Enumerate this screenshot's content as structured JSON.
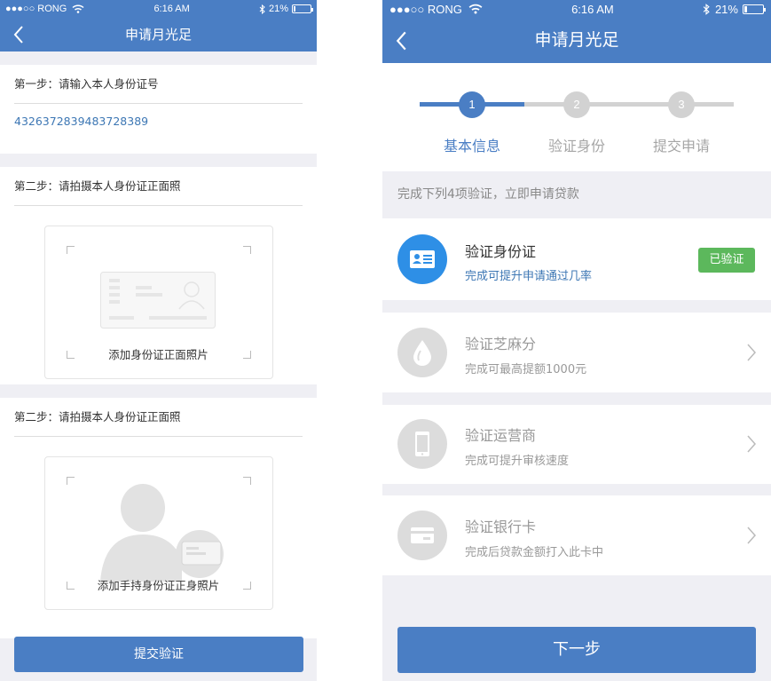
{
  "status": {
    "carrier": "●●●○○ RONG",
    "time": "6:16 AM",
    "battery": "21%",
    "battery_level": 0.21
  },
  "left": {
    "title": "申请月光足",
    "step1_label": "第一步：请输入本人身份证号",
    "id_number": "4326372839483728389",
    "step2_label": "第二步：请拍摄本人身份证正面照",
    "card_placeholder": "添加身份证正面照片",
    "step3_label": "第二步：请拍摄本人身份证正面照",
    "hand_placeholder": "添加手持身份证正身照片",
    "submit": "提交验证"
  },
  "right": {
    "title": "申请月光足",
    "steps": [
      {
        "num": "1",
        "label": "基本信息",
        "active": true
      },
      {
        "num": "2",
        "label": "验证身份",
        "active": false
      },
      {
        "num": "3",
        "label": "提交申请",
        "active": false
      }
    ],
    "hint": "完成下列4项验证，立即申请贷款",
    "items": [
      {
        "title": "验证身份证",
        "sub": "完成可提升申请通过几率",
        "icon": "id-card-icon",
        "status": "已验证",
        "done": true
      },
      {
        "title": "验证芝麻分",
        "sub": "完成可最高提额1000元",
        "icon": "sesame-drop-icon",
        "done": false
      },
      {
        "title": "验证运营商",
        "sub": "完成可提升审核速度",
        "icon": "phone-icon",
        "done": false
      },
      {
        "title": "验证银行卡",
        "sub": "完成后贷款金额打入此卡中",
        "icon": "bank-card-icon",
        "done": false
      }
    ],
    "next": "下一步"
  },
  "colors": {
    "primary": "#4a7ec4",
    "success": "#5cb85c",
    "muted_icon": "#dcdcdc",
    "link": "#3d77b4"
  }
}
